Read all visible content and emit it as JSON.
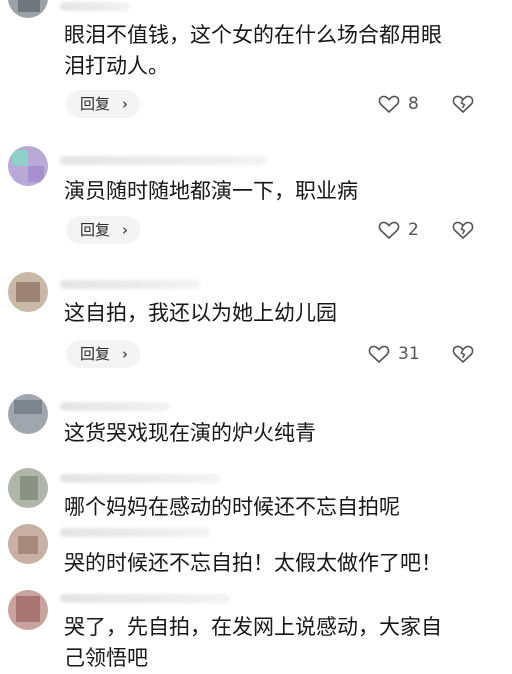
{
  "comments": [
    {
      "text": "眼泪不值钱，这个女的在什么场合都用眼\n泪打动人。",
      "reply_label": "回复",
      "likes": "8"
    },
    {
      "text": "演员随时随地都演一下，职业病",
      "reply_label": "回复",
      "likes": "2"
    },
    {
      "text": "这自拍，我还以为她上幼儿园",
      "reply_label": "回复",
      "likes": "31"
    },
    {
      "text": "这货哭戏现在演的炉火纯青"
    },
    {
      "text": "哪个妈妈在感动的时候还不忘自拍呢"
    },
    {
      "text": "哭的时候还不忘自拍！太假太做作了吧！"
    },
    {
      "text": "哭了，先自拍，在发网上说感动，大家自\n己领悟吧"
    }
  ]
}
